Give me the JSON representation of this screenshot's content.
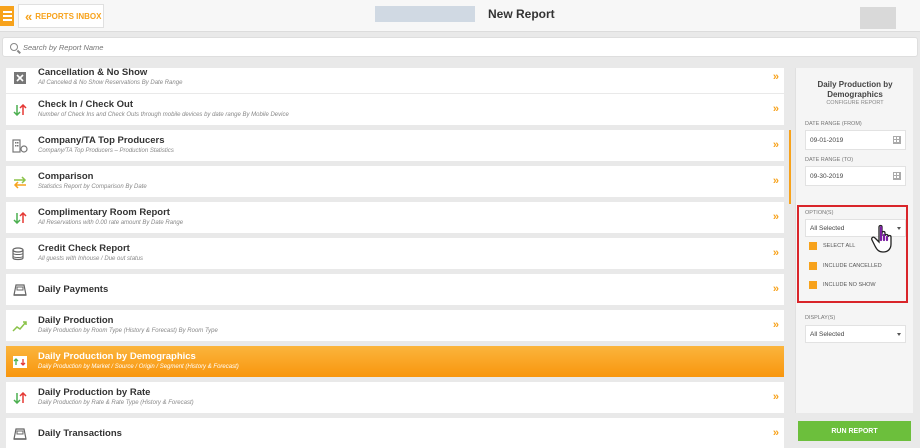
{
  "header": {
    "back_label": "REPORTS INBOX",
    "title": "New Report"
  },
  "search": {
    "placeholder": "Search by Report Name"
  },
  "reports": [
    {
      "title": "Cancellation & No Show",
      "desc": "All Canceled & No Show Reservations By Date Range",
      "icon": "x-box-icon"
    },
    {
      "title": "Check In / Check Out",
      "desc": "Number of Check Ins and Check Outs through mobile devices by date range By Mobile Device",
      "icon": "updown-arrows-icon"
    },
    {
      "title": "Company/TA Top Producers",
      "desc": "Company/TA Top Producers – Production Statistics",
      "icon": "building-icon"
    },
    {
      "title": "Comparison",
      "desc": "Statistics Report by Comparison By Date",
      "icon": "swap-arrows-icon"
    },
    {
      "title": "Complimentary Room Report",
      "desc": "All Reservations with 0.00 rate amount By Date Range",
      "icon": "updown-arrows-icon"
    },
    {
      "title": "Credit Check Report",
      "desc": "All guests with Inhouse / Due out status",
      "icon": "coins-icon"
    },
    {
      "title": "Daily Payments",
      "desc": "",
      "icon": "register-icon"
    },
    {
      "title": "Daily Production",
      "desc": "Daily Production by Room Type (History & Forecast) By Room Type",
      "icon": "trend-chart-icon"
    },
    {
      "title": "Daily Production by Demographics",
      "desc": "Daily Production by Market / Source / Origin / Segment (History & Forecast)",
      "icon": "demographics-chart-icon"
    },
    {
      "title": "Daily Production by Rate",
      "desc": "Daily Production by Rate & Rate Type (History & Forecast)",
      "icon": "updown-arrows-icon"
    },
    {
      "title": "Daily Transactions",
      "desc": "",
      "icon": "register-icon"
    }
  ],
  "active_report_index": 8,
  "panel": {
    "title": "Daily Production by Demographics",
    "subtitle": "CONFIGURE REPORT",
    "date_from_label": "DATE RANGE (FROM)",
    "date_from_value": "09-01-2019",
    "date_to_label": "DATE RANGE (TO)",
    "date_to_value": "09-30-2019",
    "options_label": "OPTION(S)",
    "options_value": "All Selected",
    "options_list": [
      "SELECT ALL",
      "INCLUDE CANCELLED",
      "INCLUDE NO SHOW"
    ],
    "display_label": "DISPLAY(S)",
    "display_value": "All Selected",
    "run_label": "RUN REPORT"
  },
  "colors": {
    "accent": "#f7a21b",
    "run_button": "#6cbf3c",
    "highlight_box": "#d9252a"
  }
}
